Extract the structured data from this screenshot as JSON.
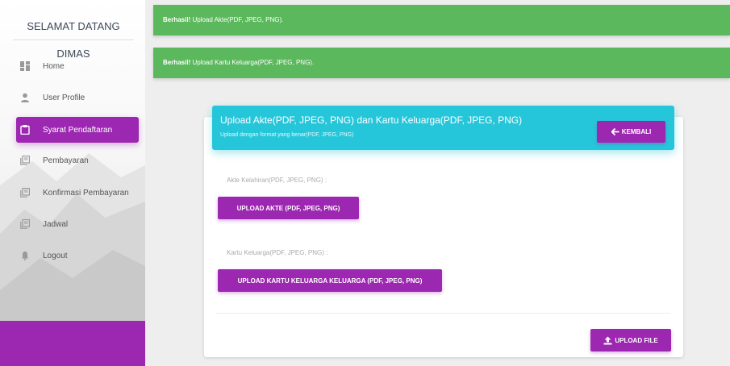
{
  "sidebar": {
    "title": "SELAMAT DATANG DIMAS",
    "items": [
      {
        "label": "Home",
        "icon": "dashboard-icon"
      },
      {
        "label": "User Profile",
        "icon": "person-icon"
      },
      {
        "label": "Syarat Pendaftaran",
        "icon": "clipboard-icon",
        "active": true
      },
      {
        "label": "Pembayaran",
        "icon": "library-books-icon"
      },
      {
        "label": "Konfirmasi Pembayaran",
        "icon": "library-books-icon"
      },
      {
        "label": "Jadwal",
        "icon": "library-books-icon"
      },
      {
        "label": "Logout",
        "icon": "bell-icon"
      }
    ]
  },
  "alerts": [
    {
      "strong": "Berhasil!",
      "text": " Upload Akte(PDF, JPEG, PNG)."
    },
    {
      "strong": "Berhasil!",
      "text": " Upload Kartu Keluarga(PDF, JPEG, PNG)."
    }
  ],
  "card": {
    "title": "Upload Akte(PDF, JPEG, PNG) dan Kartu Keluarga(PDF, JPEG, PNG)",
    "subtitle": "Upload dengan format yang benar(PDF, JPEG, PNG)",
    "back_label": "KEMBALI",
    "akte_label": "Akte Kelahiran(PDF, JPEG, PNG) :",
    "akte_button": "UPLOAD AKTE (PDF, JPEG, PNG)",
    "kk_label": "Kartu Keluarga(PDF, JPEG, PNG) :",
    "kk_button": "UPLOAD KARTU KELUARGA KELUARGA (PDF, JPEG, PNG)",
    "submit_label": "UPLOAD FILE"
  },
  "colors": {
    "primary": "#9c27b0",
    "info": "#26c6da",
    "success": "#5cb85c"
  }
}
